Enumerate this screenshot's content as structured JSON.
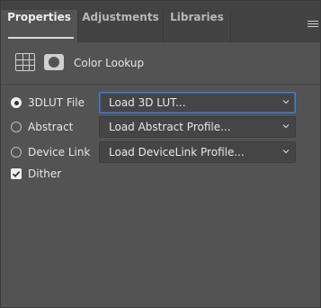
{
  "tabs": [
    {
      "label": "Properties",
      "active": true
    },
    {
      "label": "Adjustments",
      "active": false
    },
    {
      "label": "Libraries",
      "active": false
    }
  ],
  "panel_menu_icon": "hamburger-menu-icon",
  "header": {
    "title": "Color Lookup",
    "icons": [
      "adjustment-layer-grid-icon",
      "layer-mask-icon"
    ]
  },
  "options": [
    {
      "label": "3DLUT File",
      "selected": true,
      "dropdown_value": "Load 3D LUT..."
    },
    {
      "label": "Abstract",
      "selected": false,
      "dropdown_value": "Load Abstract Profile..."
    },
    {
      "label": "Device Link",
      "selected": false,
      "dropdown_value": "Load DeviceLink Profile..."
    }
  ],
  "dither": {
    "label": "Dither",
    "checked": true
  },
  "colors": {
    "panel_bg": "#535353",
    "tab_bar_bg": "#434343",
    "focus_border": "#4b7cc4"
  }
}
